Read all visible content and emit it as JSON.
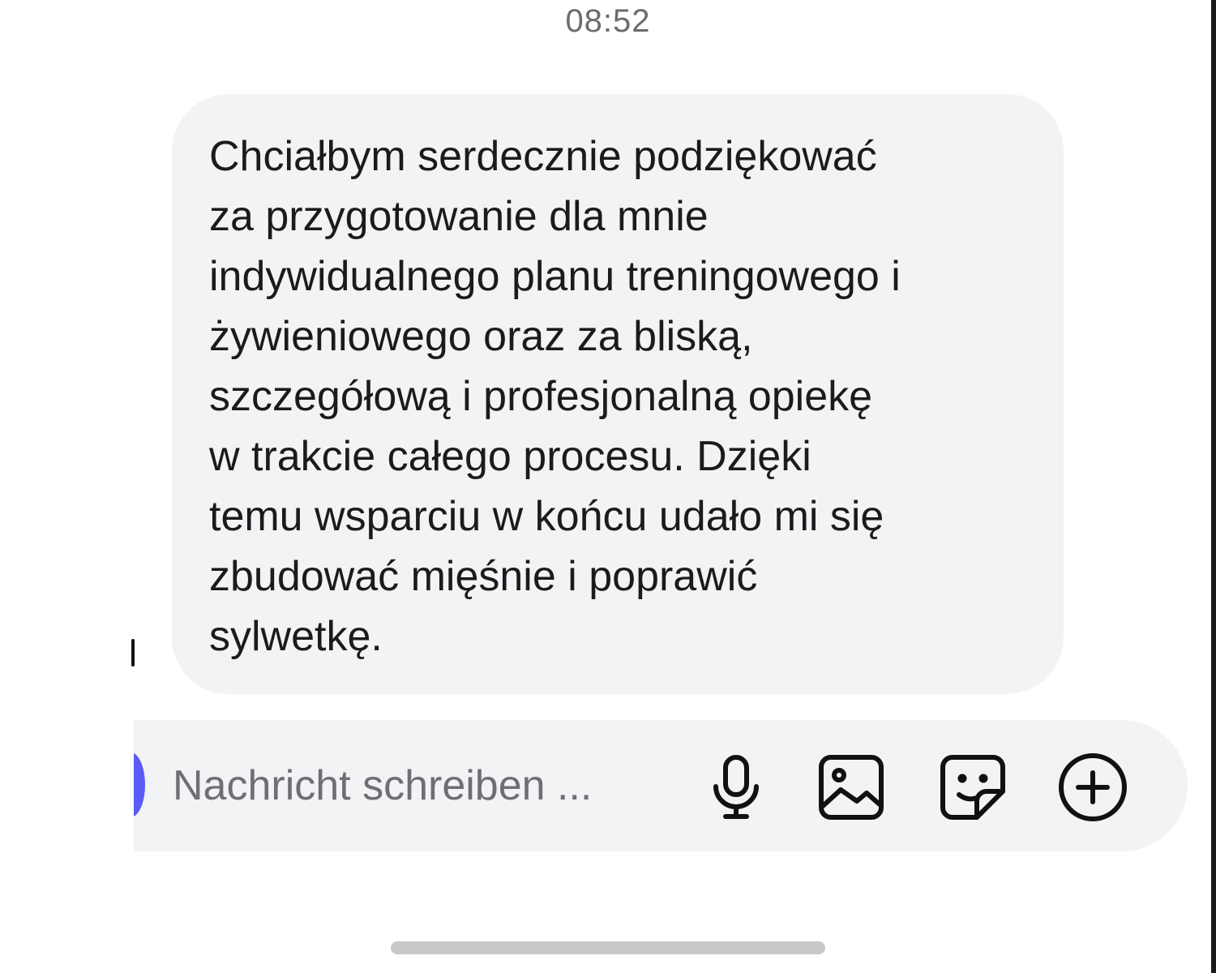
{
  "status": {
    "time": "08:52"
  },
  "message": {
    "text": "Chciałbym serdecznie podziękować\nza przygotowanie dla mnie\nindywidualnego planu treningowego i\nżywieniowego oraz za bliską,\nszczegółową i profesjonalną opiekę\nw trakcie całego procesu. Dzięki\ntemu wsparciu w końcu udało mi się\nzbudować mięśnie i poprawić\nsylwetkę."
  },
  "composer": {
    "placeholder": "Nachricht schreiben ...",
    "icons": [
      "microphone-icon",
      "image-icon",
      "sticker-icon",
      "plus-circle-icon"
    ]
  },
  "colors": {
    "bubble": "#f2f3f5",
    "text": "#1b1b1d",
    "placeholder": "#6e6e73",
    "avatar_accent": "#5b5bf5"
  }
}
